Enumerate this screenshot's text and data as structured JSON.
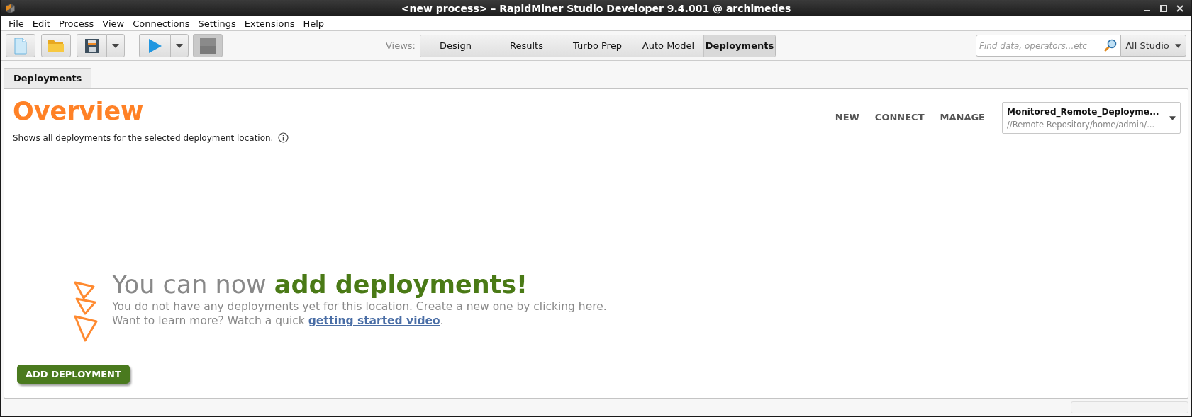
{
  "window": {
    "title": "<new process> – RapidMiner Studio Developer 9.4.001 @ archimedes"
  },
  "menu_bar": [
    "File",
    "Edit",
    "Process",
    "View",
    "Connections",
    "Settings",
    "Extensions",
    "Help"
  ],
  "views": {
    "label": "Views:",
    "buttons": [
      {
        "label": "Design",
        "selected": false
      },
      {
        "label": "Results",
        "selected": false
      },
      {
        "label": "Turbo Prep",
        "selected": false
      },
      {
        "label": "Auto Model",
        "selected": false
      },
      {
        "label": "Deployments",
        "selected": true
      }
    ]
  },
  "search": {
    "placeholder": "Find data, operators...etc",
    "scope": "All Studio"
  },
  "tabs": [
    {
      "label": "Deployments",
      "selected": true
    }
  ],
  "overview": {
    "title": "Overview",
    "subtitle": "Shows all deployments for the selected deployment location.",
    "actions": [
      "NEW",
      "CONNECT",
      "MANAGE"
    ],
    "location": {
      "name": "Monitored_Remote_Deployme...",
      "path": "//Remote Repository/home/admin/..."
    }
  },
  "empty_state": {
    "headline": "You can now **add deployments!**",
    "line_1": "You do not have any deployments yet for this location. Create a new one by clicking here.",
    "line_2": "Want to learn more? Watch a quick ",
    "link": "getting started video",
    "line_2_end": ".",
    "button": "ADD DEPLOYMENT"
  }
}
